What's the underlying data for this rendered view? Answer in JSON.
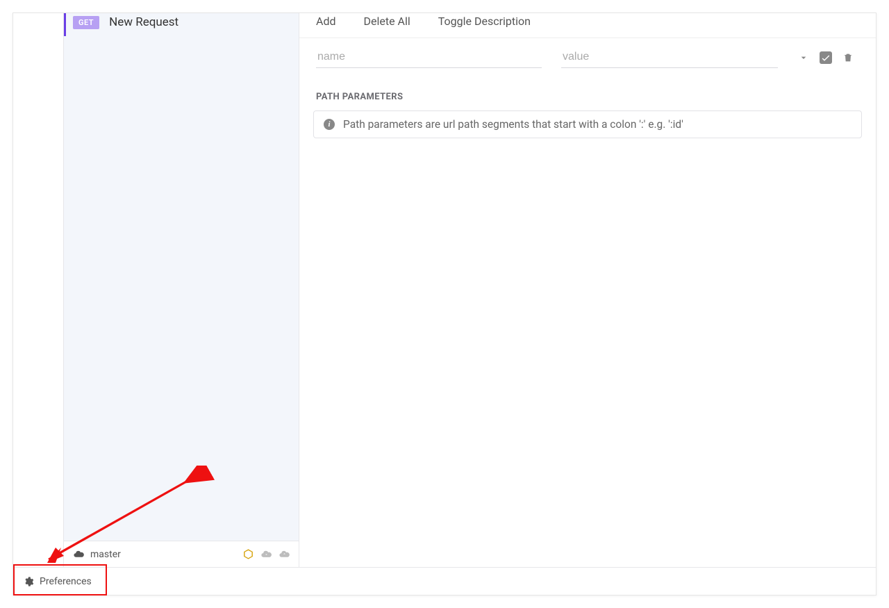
{
  "sidebar": {
    "request": {
      "method": "GET",
      "name": "New Request"
    },
    "branch": {
      "name": "master"
    }
  },
  "toolbar": {
    "add": "Add",
    "delete_all": "Delete All",
    "toggle_description": "Toggle Description"
  },
  "param_row": {
    "name_placeholder": "name",
    "value_placeholder": "value"
  },
  "path_params": {
    "title": "PATH PARAMETERS",
    "info": "Path parameters are url path segments that start with a colon ':' e.g. ':id'"
  },
  "footer": {
    "preferences": "Preferences"
  }
}
